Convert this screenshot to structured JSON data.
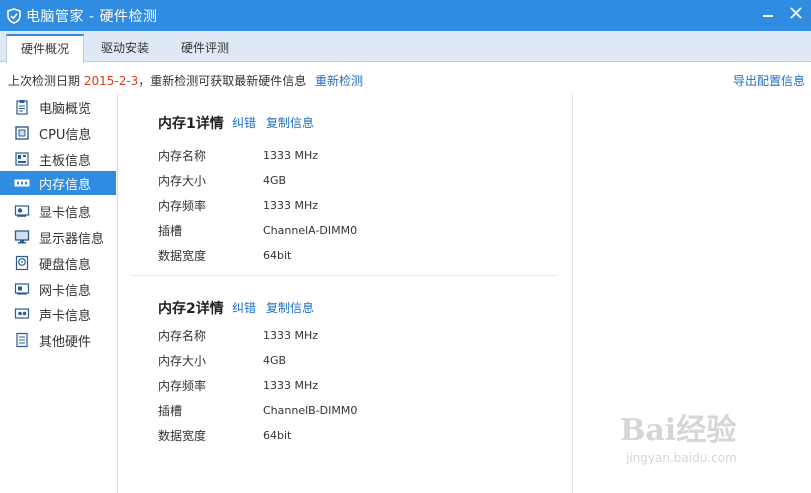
{
  "window": {
    "title": "电脑管家 - 硬件检测"
  },
  "tabs": [
    "硬件概况",
    "驱动安装",
    "硬件评测"
  ],
  "info": {
    "prefix": "上次检测日期 ",
    "date": "2015-2-3",
    "suffix": "，重新检测可获取最新硬件信息",
    "recheck": "重新检测",
    "export": "导出配置信息"
  },
  "sidebar": [
    {
      "label": "电脑概览",
      "icon": "clipboard-icon"
    },
    {
      "label": "CPU信息",
      "icon": "cpu-icon"
    },
    {
      "label": "主板信息",
      "icon": "motherboard-icon"
    },
    {
      "label": "内存信息",
      "icon": "memory-icon"
    },
    {
      "label": "显卡信息",
      "icon": "graphics-card-icon"
    },
    {
      "label": "显示器信息",
      "icon": "monitor-icon"
    },
    {
      "label": "硬盘信息",
      "icon": "hard-disk-icon"
    },
    {
      "label": "网卡信息",
      "icon": "network-card-icon"
    },
    {
      "label": "声卡信息",
      "icon": "sound-card-icon"
    },
    {
      "label": "其他硬件",
      "icon": "other-hardware-icon"
    }
  ],
  "memory": [
    {
      "title": "内存1详情",
      "correct": "纠错",
      "copy": "复制信息",
      "rows": [
        {
          "k": "内存名称",
          "v": "1333 MHz"
        },
        {
          "k": "内存大小",
          "v": "4GB"
        },
        {
          "k": "内存频率",
          "v": "1333 MHz"
        },
        {
          "k": "插槽",
          "v": "ChannelA-DIMM0"
        },
        {
          "k": "数据宽度",
          "v": "64bit"
        }
      ]
    },
    {
      "title": "内存2详情",
      "correct": "纠错",
      "copy": "复制信息",
      "rows": [
        {
          "k": "内存名称",
          "v": "1333 MHz"
        },
        {
          "k": "内存大小",
          "v": "4GB"
        },
        {
          "k": "内存频率",
          "v": "1333 MHz"
        },
        {
          "k": "插槽",
          "v": "ChannelB-DIMM0"
        },
        {
          "k": "数据宽度",
          "v": "64bit"
        }
      ]
    }
  ],
  "watermark": {
    "big": "Bai经验",
    "small": "jingyan.baidu.com"
  }
}
